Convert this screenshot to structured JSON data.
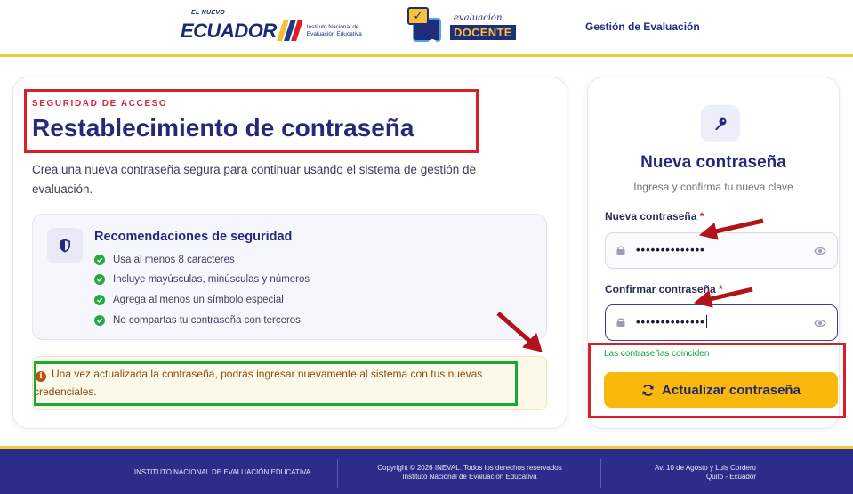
{
  "header": {
    "ecuador_logo": {
      "small": "EL NUEVO",
      "word": "ECUADOR",
      "institute_line1": "Instituto Nacional de",
      "institute_line2": "Evaluación Educativa",
      "stripe_colors": [
        "#f2c12e",
        "#1f3a8a",
        "#d61f26"
      ]
    },
    "docente_logo": {
      "script": "evaluación",
      "word": "DOCENTE"
    },
    "nav_link": "Gestión de Evaluación"
  },
  "left_panel": {
    "kicker": "SEGURIDAD DE ACCESO",
    "title": "Restablecimiento de contraseña",
    "description": "Crea una nueva contraseña segura para continuar usando el sistema de gestión de evaluación.",
    "recommendations": {
      "icon": "shield-icon",
      "title": "Recomendaciones de seguridad",
      "items": [
        "Usa al menos 8 caracteres",
        "Incluye mayúsculas, minúsculas y números",
        "Agrega al menos un símbolo especial",
        "No compartas tu contraseña con terceros"
      ]
    },
    "info_notice": "Una vez actualizada la contraseña, podrás ingresar nuevamente al sistema con tus nuevas credenciales."
  },
  "right_panel": {
    "icon": "key-icon",
    "title": "Nueva contraseña",
    "subtitle": "Ingresa y confirma tu nueva clave",
    "new_password": {
      "label": "Nueva contraseña",
      "required_mark": "*",
      "value": "••••••••••••••"
    },
    "confirm_password": {
      "label": "Confirmar contraseña",
      "required_mark": "*",
      "value": "••••••••••••••"
    },
    "match_message": "Las contraseñas coinciden",
    "submit_label": "Actualizar contraseña"
  },
  "footer": {
    "col1": "INSTITUTO NACIONAL DE EVALUACIÓN EDUCATIVA",
    "col2_line1": "Copyright © 2026 INEVAL. Todos los derechos reservados",
    "col2_line2": "Instituto Nacional de Evaluación Educativa",
    "col3_line1": "Av. 10 de Agosto y Luis Cordero",
    "col3_line2": "Quito - Ecuador"
  },
  "colors": {
    "navy": "#25297a",
    "accent_yellow": "#f8b80c",
    "kicker_red": "#d0293c",
    "annotation_red": "#d8202b",
    "annotation_green": "#19a73a",
    "arrow": "#b3121b",
    "success_green": "#16a34a",
    "footer_bg": "#2c2d8a"
  }
}
